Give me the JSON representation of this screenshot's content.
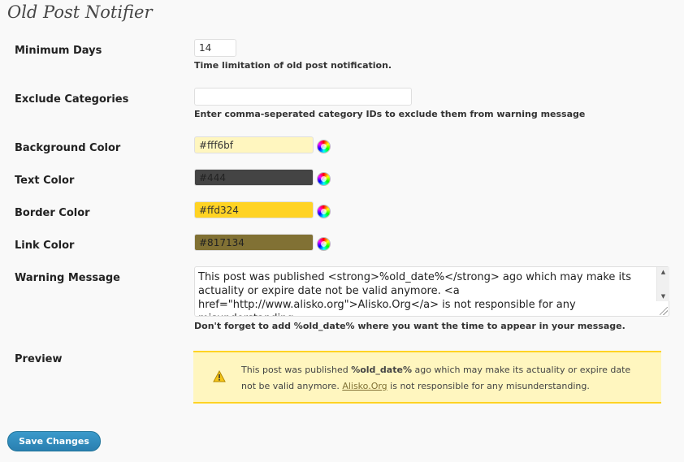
{
  "page": {
    "title": "Old Post Notifier"
  },
  "fields": {
    "min_days": {
      "label": "Minimum Days",
      "value": "14",
      "description": "Time limitation of old post notification."
    },
    "exclude_categories": {
      "label": "Exclude Categories",
      "value": "",
      "description": "Enter comma-seperated category IDs to exclude them from warning message"
    },
    "background_color": {
      "label": "Background Color",
      "value": "#fff6bf",
      "swatch": "#fff6bf",
      "text_color": "#333333"
    },
    "text_color": {
      "label": "Text Color",
      "value": "#444",
      "swatch": "#444444",
      "text_color": "#222222"
    },
    "border_color": {
      "label": "Border Color",
      "value": "#ffd324",
      "swatch": "#ffd324",
      "text_color": "#333333"
    },
    "link_color": {
      "label": "Link Color",
      "value": "#817134",
      "swatch": "#817134",
      "text_color": "#222222"
    },
    "warning_message": {
      "label": "Warning Message",
      "value": "This post was published <strong>%old_date%</strong> ago which may make its actuality or expire date not be valid anymore. <a href=\"http://www.alisko.org\">Alisko.Org</a> is not responsible for any misunderstanding.",
      "description": "Don't forget to add %old_date% where you want the time to appear in your message."
    }
  },
  "preview": {
    "label": "Preview",
    "text_before": "This post was published ",
    "date_token": "%old_date%",
    "text_middle": " ago which may make its actuality or expire date not be valid anymore. ",
    "link_text": "Alisko.Org",
    "text_after": " is not responsible for any misunderstanding."
  },
  "icons": {
    "color_picker": "color-wheel-icon",
    "preview_warning": "warning-triangle-icon",
    "scroll_up": "arrow-up-icon",
    "scroll_down": "arrow-down-icon"
  },
  "buttons": {
    "save_label": "Save Changes"
  },
  "colors": {
    "accent_button": "#21759b",
    "preview_background": "#fff6bf",
    "preview_border": "#ffd324",
    "preview_text": "#444444",
    "preview_link": "#817134"
  }
}
